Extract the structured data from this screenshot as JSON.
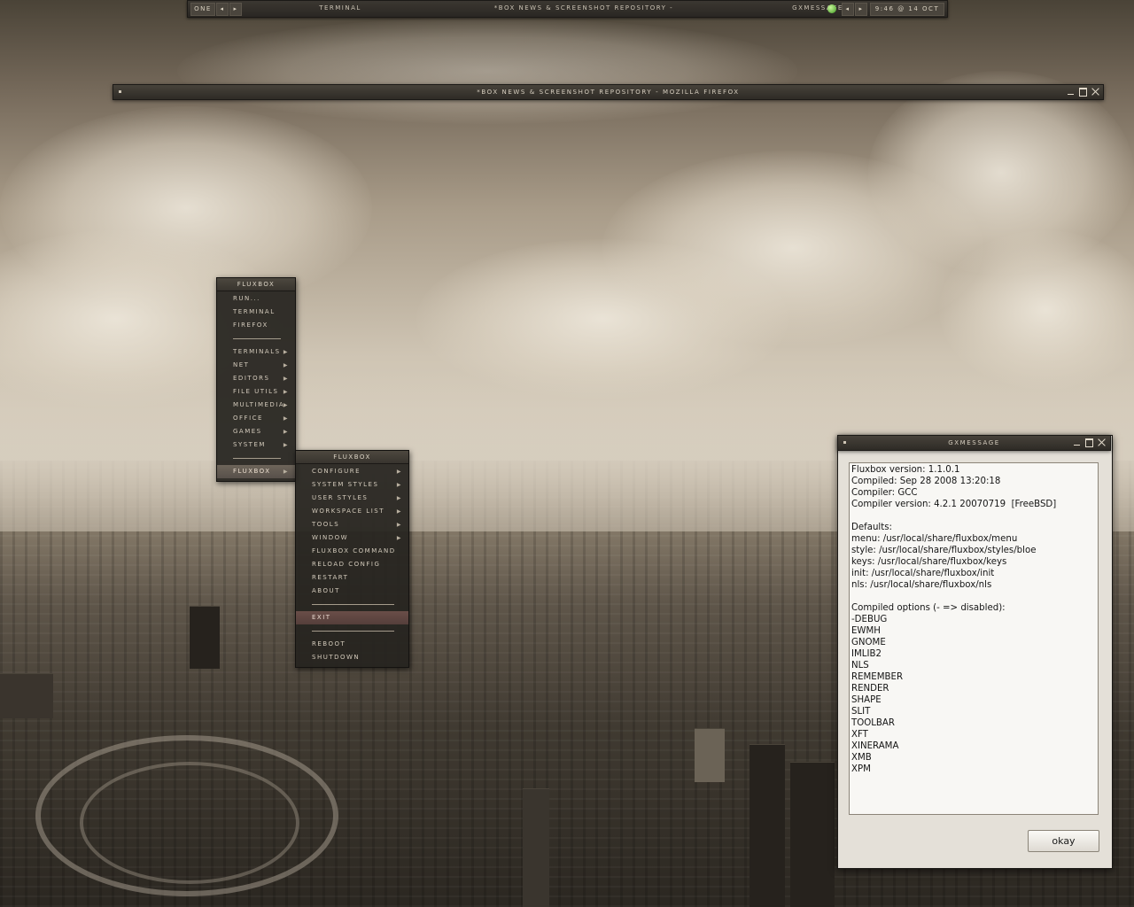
{
  "toolbar": {
    "workspace": "ONE",
    "prev_ws_icon": "left-triangle-icon",
    "next_ws_icon": "right-triangle-icon",
    "tasks": [
      "TERMINAL",
      "*BOX NEWS & SCREENSHOT REPOSITORY -",
      "GXMESSAGE"
    ],
    "clock": "9:46 @ 14 OCT"
  },
  "firefox_window": {
    "title": "*BOX NEWS & SCREENSHOT REPOSITORY - MOZILLA FIREFOX"
  },
  "root_menu": {
    "title": "FLUXBOX",
    "items": [
      {
        "label": "RUN..."
      },
      {
        "label": "TERMINAL"
      },
      {
        "label": "FIREFOX"
      },
      {
        "separator": true
      },
      {
        "label": "TERMINALS",
        "submenu": true
      },
      {
        "label": "NET",
        "submenu": true
      },
      {
        "label": "EDITORS",
        "submenu": true
      },
      {
        "label": "FILE UTILS",
        "submenu": true
      },
      {
        "label": "MULTIMEDIA",
        "submenu": true
      },
      {
        "label": "OFFICE",
        "submenu": true
      },
      {
        "label": "GAMES",
        "submenu": true
      },
      {
        "label": "SYSTEM",
        "submenu": true
      },
      {
        "separator": true
      },
      {
        "label": "FLUXBOX",
        "submenu": true,
        "active": true
      }
    ]
  },
  "fluxbox_submenu": {
    "title": "FLUXBOX",
    "items": [
      {
        "label": "CONFIGURE",
        "submenu": true
      },
      {
        "label": "SYSTEM STYLES",
        "submenu": true
      },
      {
        "label": "USER STYLES",
        "submenu": true
      },
      {
        "label": "WORKSPACE LIST",
        "submenu": true
      },
      {
        "label": "TOOLS",
        "submenu": true
      },
      {
        "label": "WINDOW",
        "submenu": true
      },
      {
        "label": "FLUXBOX COMMAND"
      },
      {
        "label": "RELOAD CONFIG"
      },
      {
        "label": "RESTART"
      },
      {
        "label": "ABOUT"
      },
      {
        "separator": true
      },
      {
        "label": "EXIT",
        "highlighted": true
      },
      {
        "separator": true
      },
      {
        "label": "REBOOT"
      },
      {
        "label": "SHUTDOWN"
      }
    ]
  },
  "gxmessage": {
    "title": "GXMESSAGE",
    "lines": [
      "Fluxbox version: 1.1.0.1",
      "Compiled: Sep 28 2008 13:20:18",
      "Compiler: GCC",
      "Compiler version: 4.2.1 20070719  [FreeBSD]",
      "",
      "Defaults:",
      "menu: /usr/local/share/fluxbox/menu",
      "style: /usr/local/share/fluxbox/styles/bloe",
      "keys: /usr/local/share/fluxbox/keys",
      "init: /usr/local/share/fluxbox/init",
      "nls: /usr/local/share/fluxbox/nls",
      "",
      "Compiled options (- => disabled):",
      "-DEBUG",
      "EWMH",
      "GNOME",
      "IMLIB2",
      "NLS",
      "REMEMBER",
      "RENDER",
      "SHAPE",
      "SLIT",
      "TOOLBAR",
      "XFT",
      "XINERAMA",
      "XMB",
      "XPM"
    ],
    "ok_label": "okay"
  },
  "colors": {
    "frame_dark": "#2e2b26",
    "menu_bg": "#26231f",
    "menu_text": "#d3cabb",
    "exit_highlight": "#6a4e48"
  }
}
